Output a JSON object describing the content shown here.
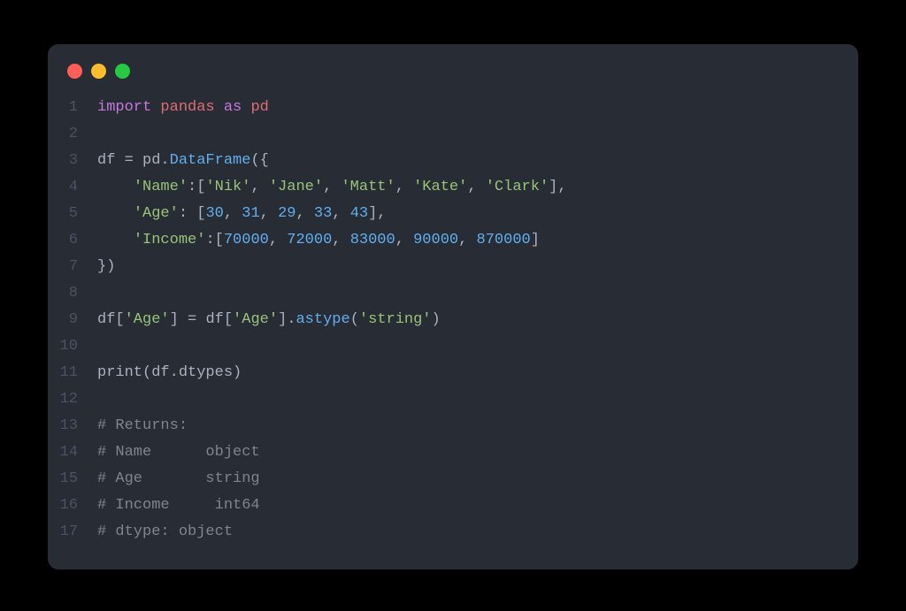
{
  "window": {
    "dots": [
      "red",
      "yellow",
      "green"
    ]
  },
  "code": {
    "lines": [
      {
        "n": "1",
        "tokens": [
          [
            "kw",
            "import"
          ],
          [
            "op",
            " "
          ],
          [
            "mod",
            "pandas"
          ],
          [
            "op",
            " "
          ],
          [
            "kw",
            "as"
          ],
          [
            "op",
            " "
          ],
          [
            "mod",
            "pd"
          ]
        ]
      },
      {
        "n": "2",
        "tokens": []
      },
      {
        "n": "3",
        "tokens": [
          [
            "id",
            "df "
          ],
          [
            "op",
            "= "
          ],
          [
            "id",
            "pd"
          ],
          [
            "op",
            "."
          ],
          [
            "fn",
            "DataFrame"
          ],
          [
            "op",
            "({"
          ]
        ]
      },
      {
        "n": "4",
        "tokens": [
          [
            "op",
            "    "
          ],
          [
            "str",
            "'Name'"
          ],
          [
            "op",
            ":["
          ],
          [
            "str",
            "'Nik'"
          ],
          [
            "op",
            ", "
          ],
          [
            "str",
            "'Jane'"
          ],
          [
            "op",
            ", "
          ],
          [
            "str",
            "'Matt'"
          ],
          [
            "op",
            ", "
          ],
          [
            "str",
            "'Kate'"
          ],
          [
            "op",
            ", "
          ],
          [
            "str",
            "'Clark'"
          ],
          [
            "op",
            "],"
          ]
        ]
      },
      {
        "n": "5",
        "tokens": [
          [
            "op",
            "    "
          ],
          [
            "str",
            "'Age'"
          ],
          [
            "op",
            ": ["
          ],
          [
            "num",
            "30"
          ],
          [
            "op",
            ", "
          ],
          [
            "num",
            "31"
          ],
          [
            "op",
            ", "
          ],
          [
            "num",
            "29"
          ],
          [
            "op",
            ", "
          ],
          [
            "num",
            "33"
          ],
          [
            "op",
            ", "
          ],
          [
            "num",
            "43"
          ],
          [
            "op",
            "],"
          ]
        ]
      },
      {
        "n": "6",
        "tokens": [
          [
            "op",
            "    "
          ],
          [
            "str",
            "'Income'"
          ],
          [
            "op",
            ":["
          ],
          [
            "num",
            "70000"
          ],
          [
            "op",
            ", "
          ],
          [
            "num",
            "72000"
          ],
          [
            "op",
            ", "
          ],
          [
            "num",
            "83000"
          ],
          [
            "op",
            ", "
          ],
          [
            "num",
            "90000"
          ],
          [
            "op",
            ", "
          ],
          [
            "num",
            "870000"
          ],
          [
            "op",
            "]"
          ]
        ]
      },
      {
        "n": "7",
        "tokens": [
          [
            "op",
            "})"
          ]
        ]
      },
      {
        "n": "8",
        "tokens": []
      },
      {
        "n": "9",
        "tokens": [
          [
            "id",
            "df"
          ],
          [
            "op",
            "["
          ],
          [
            "str",
            "'Age'"
          ],
          [
            "op",
            "] = "
          ],
          [
            "id",
            "df"
          ],
          [
            "op",
            "["
          ],
          [
            "str",
            "'Age'"
          ],
          [
            "op",
            "]."
          ],
          [
            "fn",
            "astype"
          ],
          [
            "op",
            "("
          ],
          [
            "str",
            "'string'"
          ],
          [
            "op",
            ")"
          ]
        ]
      },
      {
        "n": "10",
        "tokens": []
      },
      {
        "n": "11",
        "tokens": [
          [
            "print",
            "print"
          ],
          [
            "op",
            "("
          ],
          [
            "id",
            "df"
          ],
          [
            "op",
            "."
          ],
          [
            "id",
            "dtypes"
          ],
          [
            "op",
            ")"
          ]
        ]
      },
      {
        "n": "12",
        "tokens": []
      },
      {
        "n": "13",
        "tokens": [
          [
            "cmt",
            "# Returns:"
          ]
        ]
      },
      {
        "n": "14",
        "tokens": [
          [
            "cmt",
            "# Name      object"
          ]
        ]
      },
      {
        "n": "15",
        "tokens": [
          [
            "cmt",
            "# Age       string"
          ]
        ]
      },
      {
        "n": "16",
        "tokens": [
          [
            "cmt",
            "# Income     int64"
          ]
        ]
      },
      {
        "n": "17",
        "tokens": [
          [
            "cmt",
            "# dtype: object"
          ]
        ]
      }
    ]
  }
}
